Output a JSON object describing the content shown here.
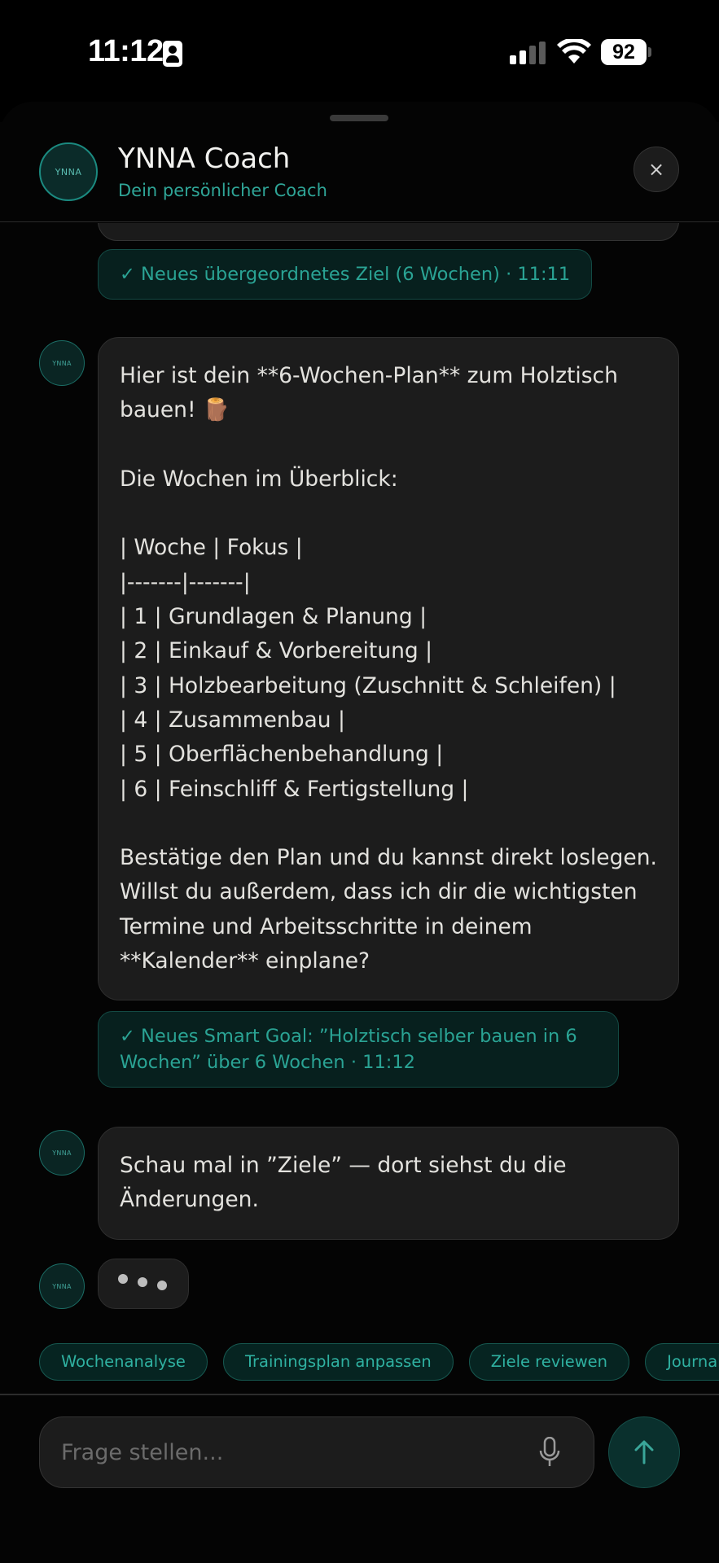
{
  "status_bar": {
    "time": "11:12",
    "battery": "92"
  },
  "header": {
    "avatar_text": "YNNA",
    "title": "YNNA Coach",
    "subtitle": "Dein persönlicher Coach",
    "close_icon": "×"
  },
  "messages": {
    "notice_1": "✓ Neues übergeordnetes Ziel (6 Wochen) · 11:11",
    "bot_1": "Hier ist dein **6-Wochen-Plan** zum Holztisch bauen! 🪵\n\nDie Wochen im Überblick:\n\n| Woche | Fokus |\n|-------|-------|\n| 1 | Grundlagen & Planung |\n| 2 | Einkauf & Vorbereitung |\n| 3 | Holzbearbeitung (Zuschnitt & Schleifen) |\n| 4 | Zusammenbau |\n| 5 | Oberflächenbehandlung |\n| 6 | Feinschliff & Fertigstellung |\n\nBestätige den Plan und du kannst direkt loslegen. Willst du außerdem, dass ich dir die wichtigsten Termine und Arbeitsschritte in deinem **Kalender** einplane?",
    "notice_2": "✓ Neues Smart Goal: ”Holztisch selber bauen in 6 Wochen” über 6 Wochen · 11:12",
    "bot_2": "Schau mal in ”Ziele” — dort siehst du die Änderungen."
  },
  "chips": [
    "Wochenanalyse",
    "Trainingsplan anpassen",
    "Ziele reviewen",
    "Journal a"
  ],
  "input": {
    "placeholder": "Frage stellen...",
    "value": ""
  },
  "icons": {
    "close": "close-icon",
    "mic": "microphone-icon",
    "send": "arrow-up-icon"
  },
  "colors": {
    "accent": "#2fa597",
    "background": "#000000",
    "bubble": "#1c1c1c"
  }
}
